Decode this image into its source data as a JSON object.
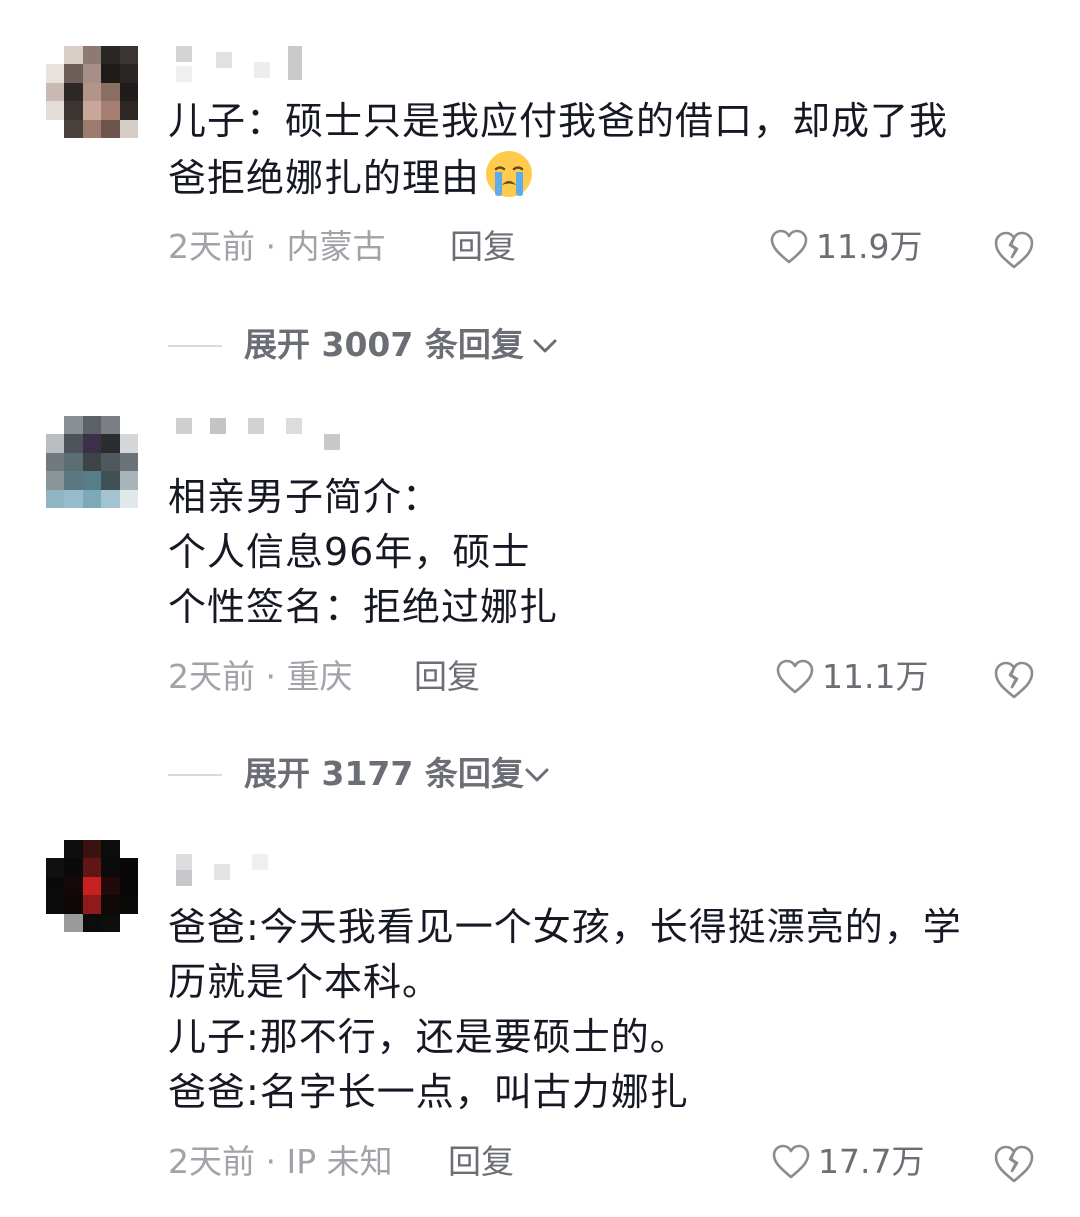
{
  "colors": {
    "primary_text": "#161823",
    "meta_text": "#a1a3a8",
    "action_text": "#6b6e75",
    "divider": "#d9dadd"
  },
  "comments": [
    {
      "text_lines": [
        "儿子：硕士只是我应付我爸的借口，却成了我",
        "爸拒绝娜扎的理由"
      ],
      "emoji": "crying-face-icon",
      "time_location": "2天前 · 内蒙古",
      "reply_label": "回复",
      "like_count": "11.9万",
      "expand_label": "展开 3007 条回复"
    },
    {
      "text_lines": [
        "相亲男子简介：",
        "个人信息96年，硕士",
        "个性签名：拒绝过娜扎"
      ],
      "time_location": "2天前 · 重庆",
      "reply_label": "回复",
      "like_count": "11.1万",
      "expand_label": "展开 3177 条回复"
    },
    {
      "text_lines": [
        "爸爸:今天我看见一个女孩，长得挺漂亮的，学",
        "历就是个本科。",
        "儿子:那不行，还是要硕士的。",
        "爸爸:名字长一点，叫古力娜扎"
      ],
      "time_location": "2天前 · IP 未知",
      "reply_label": "回复",
      "like_count": "17.7万"
    }
  ]
}
